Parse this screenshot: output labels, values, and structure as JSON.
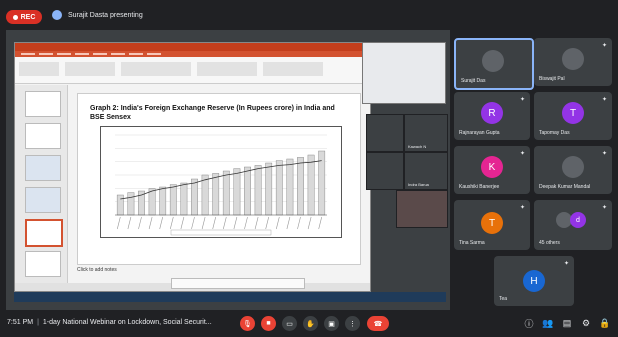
{
  "meeting": {
    "rec_label": "REC",
    "presenter_text": "Surajit Dasta presenting",
    "time": "7:51 PM",
    "title": "1-day National Webinar on Lockdown, Social Securit..."
  },
  "slide": {
    "title": "Graph 2: India's Foreign Exchange Reserve (In Rupees crore) in India and BSE Sensex",
    "notes_placeholder": "Click to add notes"
  },
  "chart_data": {
    "type": "bar",
    "values": [
      25,
      28,
      30,
      33,
      35,
      38,
      40,
      45,
      50,
      52,
      55,
      58,
      60,
      62,
      65,
      68,
      70,
      72,
      75,
      80
    ],
    "line_values": [
      20,
      22,
      25,
      30,
      33,
      35,
      38,
      40,
      44,
      47,
      50,
      52,
      55,
      58,
      60,
      62,
      63,
      65,
      66,
      68
    ]
  },
  "participants": [
    {
      "name": "Surajit Das",
      "type": "photo"
    },
    {
      "name": "Biswajit Pal",
      "type": "photo"
    },
    {
      "name": "Rajnarayan Gupta",
      "initial": "R",
      "color": "#9334e6"
    },
    {
      "name": "Tapomay Das",
      "initial": "T",
      "color": "#9334e6"
    },
    {
      "name": "Kaushiki Banerjee",
      "initial": "K",
      "color": "#e52592"
    },
    {
      "name": "Deepak Kumar Mandal",
      "type": "photo"
    },
    {
      "name": "Tina Sarma",
      "initial": "T",
      "color": "#e8710a"
    },
    {
      "name": "45 others",
      "type": "group"
    },
    {
      "name": "Tea",
      "initial": "H",
      "color": "#1967d2"
    }
  ],
  "overlay_names": [
    "Kawach N",
    "Indra Barua"
  ],
  "colors": {
    "rec": "#d93025",
    "end_call": "#ea4335",
    "ppt": "#d35230"
  }
}
